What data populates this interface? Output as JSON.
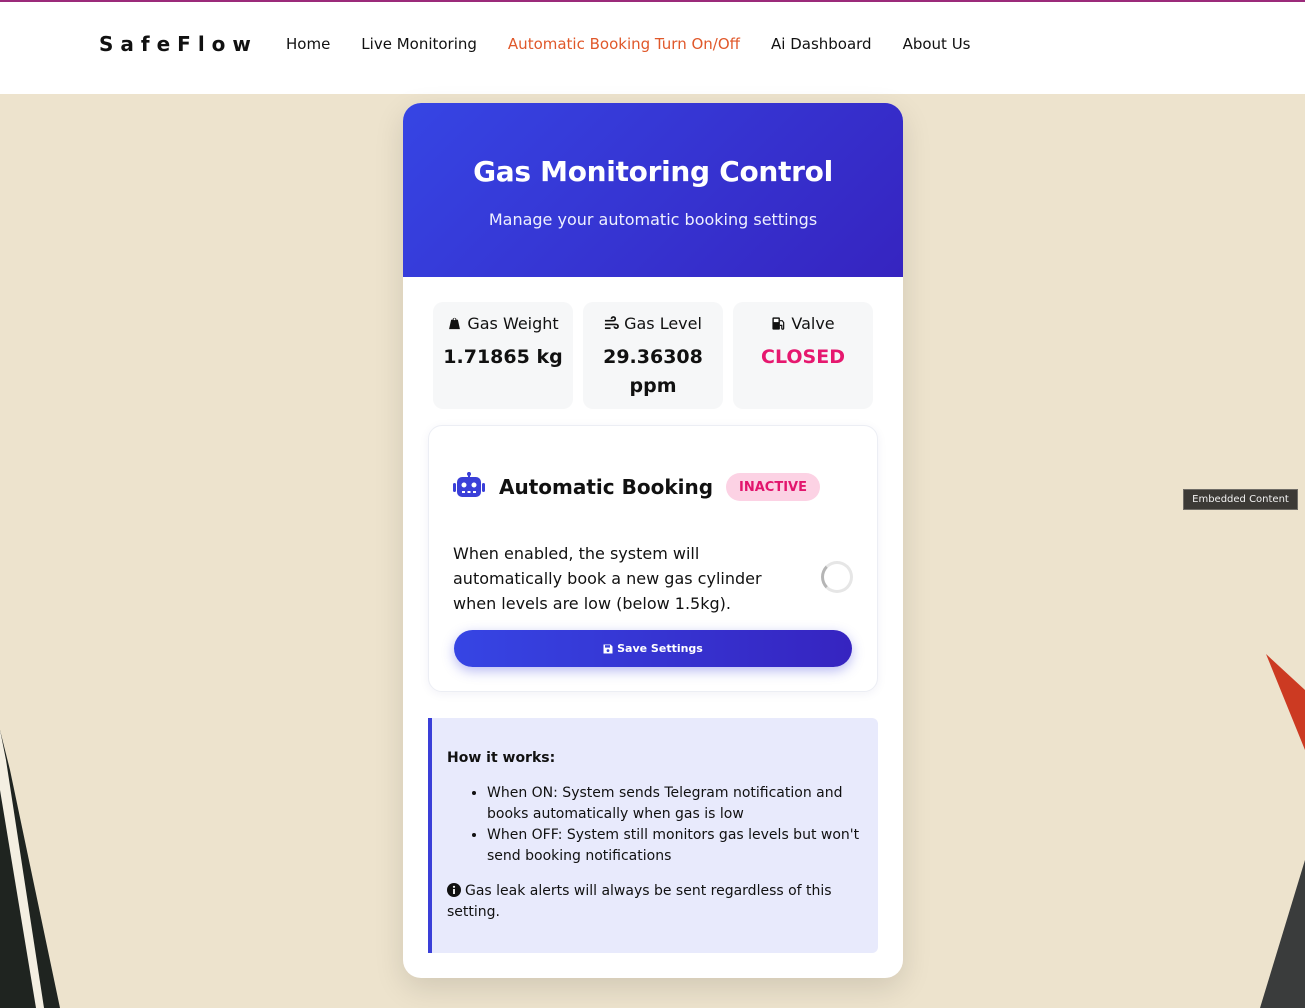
{
  "nav": {
    "brand": "SafeFlow",
    "links": [
      {
        "label": "Home",
        "active": false
      },
      {
        "label": "Live Monitoring",
        "active": false
      },
      {
        "label": "Automatic Booking Turn On/Off",
        "active": true
      },
      {
        "label": "Ai Dashboard",
        "active": false
      },
      {
        "label": "About Us",
        "active": false
      }
    ]
  },
  "header": {
    "title": "Gas Monitoring Control",
    "subtitle": "Manage your automatic booking settings"
  },
  "stats": {
    "weight": {
      "label": "Gas Weight",
      "value": "1.71865 kg",
      "icon": "weight-icon"
    },
    "level": {
      "label": "Gas Level",
      "value": "29.36308 ppm",
      "icon": "wind-icon"
    },
    "valve": {
      "label": "Valve",
      "value": "CLOSED",
      "icon": "gas-pump-icon"
    }
  },
  "booking": {
    "title": "Automatic Booking",
    "status": "INACTIVE",
    "description": "When enabled, the system will automatically book a new gas cylinder when levels are low (below 1.5kg).",
    "save_label": "Save Settings"
  },
  "info": {
    "title": "How it works:",
    "items": [
      "When ON: System sends Telegram notification and books automatically when gas is low",
      "When OFF: System still monitors gas levels but won't send booking notifications"
    ],
    "note": "Gas leak alerts will always be sent regardless of this setting."
  },
  "embedded_label": "Embedded Content",
  "colors": {
    "accent": "#3645e4",
    "accent_dark": "#3624c0",
    "nav_active": "#e0582a",
    "status_closed": "#e6186f",
    "badge_bg": "#fcd2e4",
    "page_bg": "#ede3cd"
  }
}
